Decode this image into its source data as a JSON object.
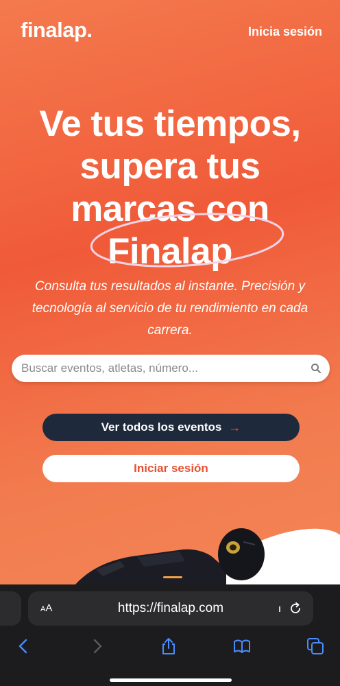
{
  "header": {
    "logo": "finalap.",
    "login_link": "Inicia sesión"
  },
  "hero": {
    "title_line1": "Ve tus tiempos,",
    "title_line2": "supera tus",
    "title_line3": "marcas con",
    "title_brand": "Finalap",
    "subtitle": "Consulta tus resultados al instante. Precisión y tecnología al servicio de tu rendimiento en cada carrera."
  },
  "search": {
    "placeholder": "Buscar eventos, atletas, número...",
    "icon": "search-icon"
  },
  "buttons": {
    "events_label": "Ver todos los eventos",
    "events_arrow": "→",
    "login_label": "Iniciar sesión"
  },
  "browser": {
    "aa_label_small": "A",
    "aa_label_big": "A",
    "url": "https://finalap.com",
    "icons": [
      "back-icon",
      "forward-icon",
      "share-icon",
      "bookmarks-icon",
      "tabs-icon",
      "reload-icon"
    ]
  },
  "colors": {
    "accent": "#f05a38",
    "dark_button": "#1e2a3b",
    "chrome_bg": "#1c1c1e",
    "ios_blue": "#4a8cff"
  }
}
